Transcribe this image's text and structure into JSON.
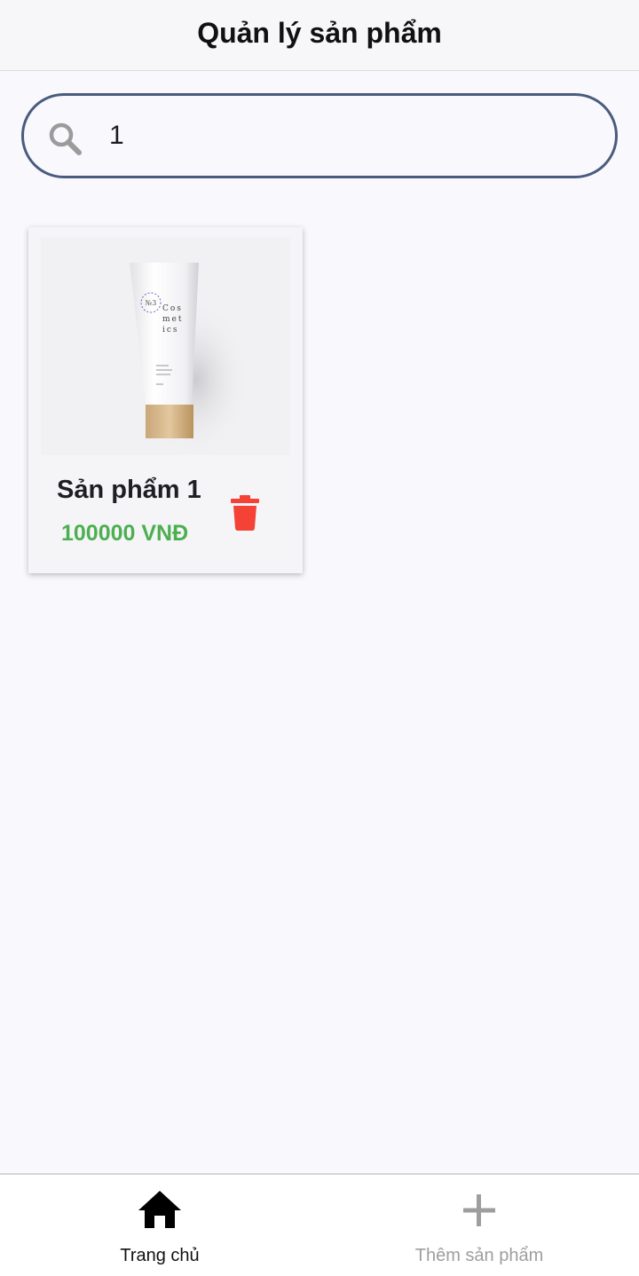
{
  "header": {
    "title": "Quản lý sản phẩm"
  },
  "search": {
    "icon": "search-icon",
    "value": "1",
    "placeholder": ""
  },
  "products": [
    {
      "name": "Sản phẩm 1",
      "price": "100000 VNĐ",
      "image_text": {
        "number": "№3",
        "brand_lines": [
          "Cos",
          "met",
          "ics"
        ]
      },
      "delete_icon": "trash-icon"
    }
  ],
  "bottom_nav": {
    "items": [
      {
        "label": "Trang chủ",
        "icon": "home-icon",
        "active": true
      },
      {
        "label": "Thêm sản phẩm",
        "icon": "plus-icon",
        "active": false
      }
    ]
  },
  "colors": {
    "search_border": "#4a5b7c",
    "price": "#4caf50",
    "delete": "#f44336",
    "active_nav": "#111111",
    "inactive_nav": "#9e9e9e"
  }
}
